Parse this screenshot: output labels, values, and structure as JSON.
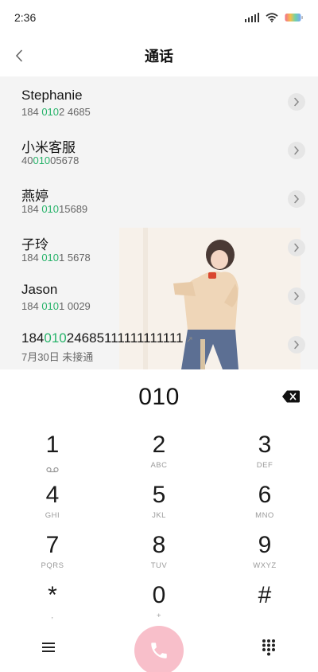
{
  "status_bar": {
    "time": "2:36"
  },
  "header": {
    "title": "通话"
  },
  "results": [
    {
      "name": "Stephanie",
      "number_pre": "184 ",
      "number_hl": "010",
      "number_post": "2 4685"
    },
    {
      "name": "小米客服",
      "number_pre": "40",
      "number_hl": "010",
      "number_post": "05678"
    },
    {
      "name": "燕婷",
      "number_pre": "184 ",
      "number_hl": "010",
      "number_post": "15689"
    },
    {
      "name": "子玲",
      "number_pre": "184 ",
      "number_hl": "010",
      "number_post": "1 5678"
    },
    {
      "name": "Jason",
      "number_pre": "184 ",
      "number_hl": "010",
      "number_post": "1 0029"
    },
    {
      "name_pre": "184",
      "name_hl": "010",
      "name_post": "24685111111111111",
      "call_info": "7月30日 未接通"
    }
  ],
  "dialer": {
    "number": "010"
  },
  "keypad": [
    {
      "digit": "1",
      "letters": ""
    },
    {
      "digit": "2",
      "letters": "ABC"
    },
    {
      "digit": "3",
      "letters": "DEF"
    },
    {
      "digit": "4",
      "letters": "GHI"
    },
    {
      "digit": "5",
      "letters": "JKL"
    },
    {
      "digit": "6",
      "letters": "MNO"
    },
    {
      "digit": "7",
      "letters": "PQRS"
    },
    {
      "digit": "8",
      "letters": "TUV"
    },
    {
      "digit": "9",
      "letters": "WXYZ"
    },
    {
      "digit": "*",
      "letters": ","
    },
    {
      "digit": "0",
      "letters": "+"
    },
    {
      "digit": "#",
      "letters": ""
    }
  ],
  "colors": {
    "highlight": "#27b36a",
    "call_button": "#f8bfca",
    "list_background": "#f4f4f4"
  },
  "icons": {
    "back": "chevron-left-icon",
    "detail": "chevron-right-icon",
    "backspace": "backspace-icon",
    "voicemail": "voicemail-icon",
    "menu": "menu-icon",
    "call": "phone-icon",
    "keypad_toggle": "dialpad-icon"
  }
}
